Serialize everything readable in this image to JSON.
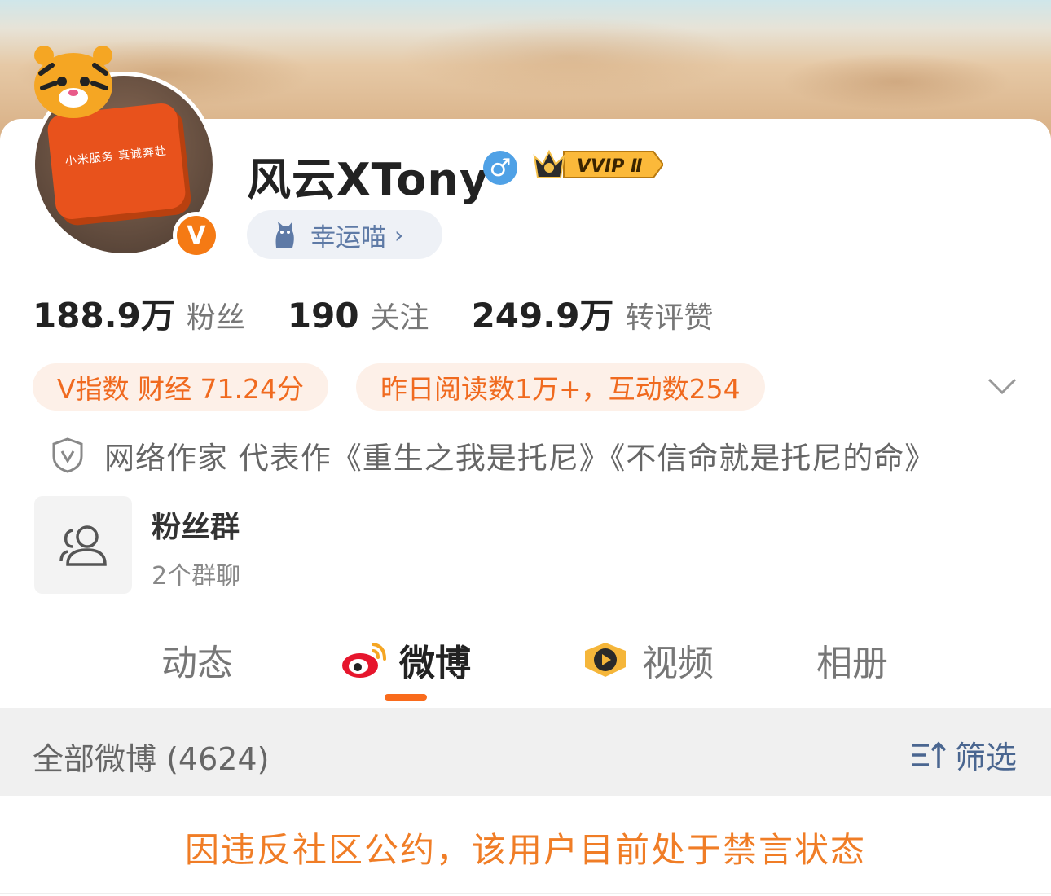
{
  "profile": {
    "name": "风云XTony",
    "vip_badge": "VVIP Ⅱ",
    "avatar_text": "小米服务 真诚奔赴",
    "verified_badge": "V",
    "lucky_tag": "幸运喵",
    "lucky_chevron": "›"
  },
  "stats": {
    "fans_count": "188.9万",
    "fans_label": "粉丝",
    "follow_count": "190",
    "follow_label": "关注",
    "likes_count": "249.9万",
    "likes_label": "转评赞"
  },
  "pills": {
    "v_index": "V指数 财经 71.24分",
    "reads": "昨日阅读数1万+，互动数254"
  },
  "description": "网络作家 代表作《重生之我是托尼》《不信命就是托尼的命》",
  "fan_group": {
    "title": "粉丝群",
    "subtitle": "2个群聊"
  },
  "tabs": [
    {
      "label": "动态",
      "active": false
    },
    {
      "label": "微博",
      "active": true
    },
    {
      "label": "视频",
      "active": false
    },
    {
      "label": "相册",
      "active": false
    }
  ],
  "filter_bar": {
    "all_posts": "全部微博 (4624)",
    "filter_label": "筛选"
  },
  "notice": "因违反社区公约，该用户目前处于禁言状态",
  "colors": {
    "accent_orange": "#f96b1c",
    "link_blue": "#4a6690",
    "male_blue": "#4fa1e6"
  },
  "icons": [
    "tiger-pendant-icon",
    "verified-v-icon",
    "male-icon",
    "vvip-crown-icon",
    "cat-icon",
    "chevron-down-icon",
    "shield-v-icon",
    "fans-group-icon",
    "weibo-logo-icon",
    "video-play-icon",
    "filter-sort-icon"
  ]
}
